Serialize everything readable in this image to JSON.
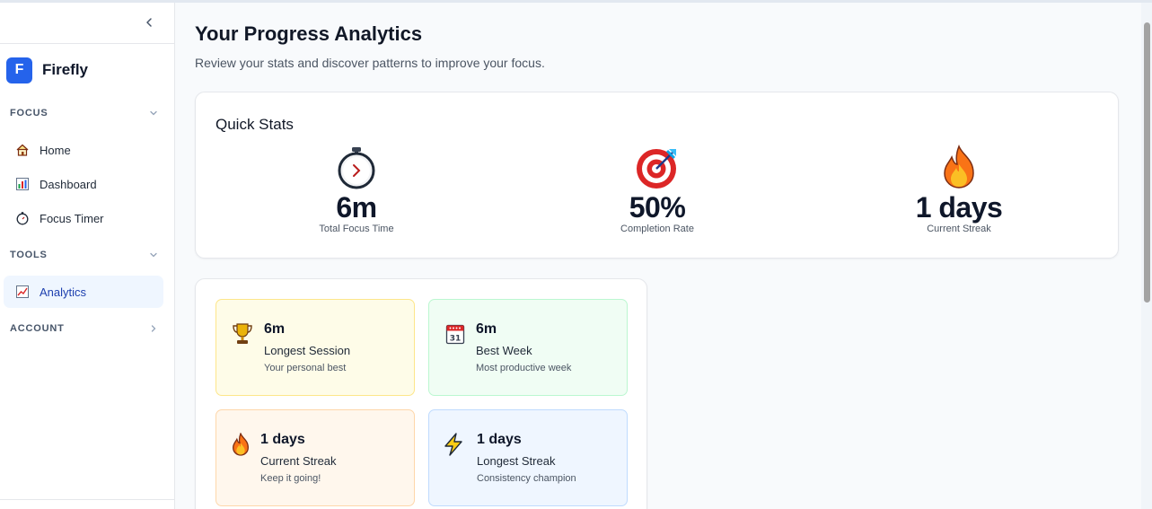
{
  "app": {
    "name": "Firefly",
    "logo_letter": "F",
    "accent": "#2563eb"
  },
  "sidebar": {
    "collapse_icon": "chevron-left-icon",
    "sections": [
      {
        "label": "FOCUS",
        "state": "expanded",
        "items": [
          {
            "label": "Home",
            "icon": "house-icon"
          },
          {
            "label": "Dashboard",
            "icon": "bar-chart-icon"
          },
          {
            "label": "Focus Timer",
            "icon": "stopwatch-icon"
          }
        ]
      },
      {
        "label": "TOOLS",
        "state": "expanded",
        "items": [
          {
            "label": "Analytics",
            "icon": "line-chart-icon",
            "active": true
          }
        ]
      },
      {
        "label": "ACCOUNT",
        "state": "collapsed",
        "items": []
      }
    ]
  },
  "page": {
    "title": "Your Progress Analytics",
    "subtitle": "Review your stats and discover patterns to improve your focus."
  },
  "quick_stats": {
    "title": "Quick Stats",
    "items": [
      {
        "icon": "stopwatch-icon",
        "value": "6m",
        "label": "Total Focus Time"
      },
      {
        "icon": "target-icon",
        "value": "50%",
        "label": "Completion Rate"
      },
      {
        "icon": "fire-icon",
        "value": "1 days",
        "label": "Current Streak"
      }
    ]
  },
  "records": [
    {
      "icon": "trophy-icon",
      "value": "6m",
      "name": "Longest Session",
      "desc": "Your personal best",
      "color": "yellow"
    },
    {
      "icon": "calendar-icon",
      "value": "6m",
      "name": "Best Week",
      "desc": "Most productive week",
      "color": "green"
    },
    {
      "icon": "fire-icon",
      "value": "1 days",
      "name": "Current Streak",
      "desc": "Keep it going!",
      "color": "orange"
    },
    {
      "icon": "lightning-icon",
      "value": "1 days",
      "name": "Longest Streak",
      "desc": "Consistency champion",
      "color": "blue"
    }
  ]
}
